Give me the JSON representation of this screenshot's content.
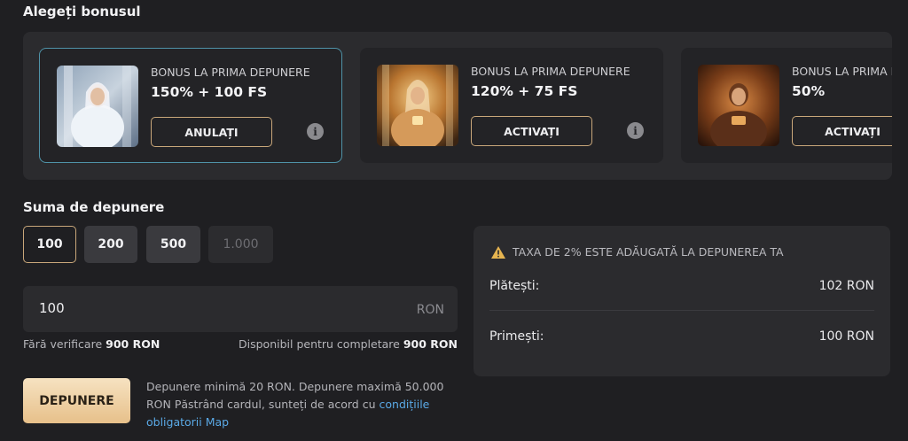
{
  "bonus": {
    "title": "Alegeți bonusul",
    "cards": [
      {
        "kicker": "BONUS LA PRIMA DEPUNERE",
        "amount": "150% + 100 FS",
        "button": "ANULAȚI",
        "selected": true
      },
      {
        "kicker": "BONUS LA PRIMA DEPUNERE",
        "amount": "120% + 75 FS",
        "button": "ACTIVAȚI",
        "selected": false
      },
      {
        "kicker": "BONUS LA PRIMA DEPUNERE",
        "amount": "50%",
        "button": "ACTIVAȚI",
        "selected": false
      }
    ],
    "info_icon": "info-icon"
  },
  "deposit": {
    "title": "Suma de depunere",
    "chips": [
      "100",
      "200",
      "500",
      "1.000"
    ],
    "input_value": "100",
    "currency": "RON",
    "hint_left_label": "Fără verificare",
    "hint_left_value": "900 RON",
    "hint_right_label": "Disponibil pentru completare",
    "hint_right_value": "900 RON",
    "button_label": "DEPUNERE",
    "note_text": "Depunere minimă 20 RON. Depunere maximă 50.000 RON Păstrând cardul, sunteți de acord cu",
    "note_link": "condițiile obligatorii Map"
  },
  "fee": {
    "warning": "TAXA DE 2% ESTE ADĂUGATĂ LA DEPUNEREA TA",
    "pay_label": "Plătești:",
    "pay_value": "102 RON",
    "receive_label": "Primești:",
    "receive_value": "100 RON"
  },
  "colors": {
    "background": "#1f1f22",
    "panel": "#2b2b2e",
    "accent_gold": "#c9a77a",
    "selected_border": "#4f93a8",
    "link": "#5aa9e6",
    "warning": "#e6b450"
  }
}
